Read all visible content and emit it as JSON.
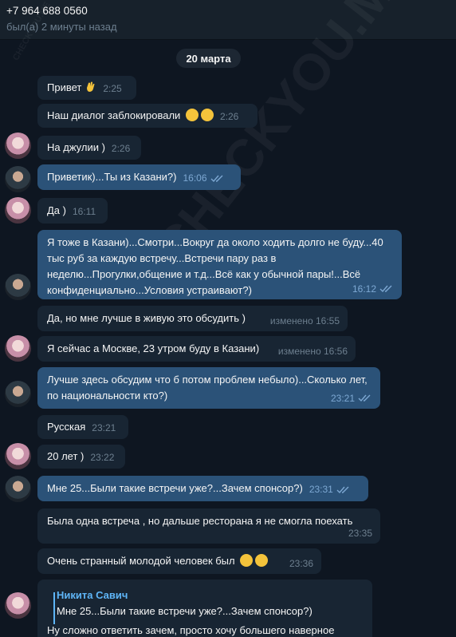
{
  "header": {
    "title": "+7 964 688 0560",
    "status": "был(а) 2 минуты назад"
  },
  "date_separator": "20 марта",
  "watermark": "CHECKYOU.ME",
  "messages": [
    {
      "text": "Привет",
      "time": "2:25",
      "emoji": "waving-hand"
    },
    {
      "text": "Наш диалог заблокировали",
      "time": "2:26"
    },
    {
      "text": "На джулии )",
      "time": "2:26"
    },
    {
      "text": "Приветик)...Ты из Казани?)",
      "time": "16:06"
    },
    {
      "text": "Да )",
      "time": "16:11"
    },
    {
      "text": "Я тоже в Казани)...Смотри...Вокруг да около ходить долго не буду...40 тыс руб за каждую встречу...Встречи пару раз в неделю...Прогулки,общение и т.д...Всё как у обычной пары!...Всё конфиденциально...Условия устраивают?)",
      "time": "16:12"
    },
    {
      "text": "Да, но мне лучше в живую это обсудить )",
      "time": "изменено 16:55"
    },
    {
      "text": "Я сейчас а Москве, 23 утром буду в Казани)",
      "time": "изменено 16:56"
    },
    {
      "text": "Лучше здесь обсудим что б потом проблем небыло)...Сколько лет, по национальности кто?)",
      "time": "23:21"
    },
    {
      "text": "Русская",
      "time": "23:21"
    },
    {
      "text": "20 лет )",
      "time": "23:22"
    },
    {
      "text": "Мне 25...Были такие встречи уже?...Зачем спонсор?)",
      "time": "23:31"
    },
    {
      "text": "Была одна встреча , но дальше ресторана я не смогла поехать",
      "time": "23:35"
    },
    {
      "text": "Очень странный молодой человек был",
      "time": "23:36"
    }
  ],
  "reply": {
    "name": "Никита Савич",
    "quoted": "Мне 25...Были такие встречи уже?...Зачем спонсор?)",
    "text_cut": "Ну сложно ответить зачем, просто хочу большего наверное"
  }
}
